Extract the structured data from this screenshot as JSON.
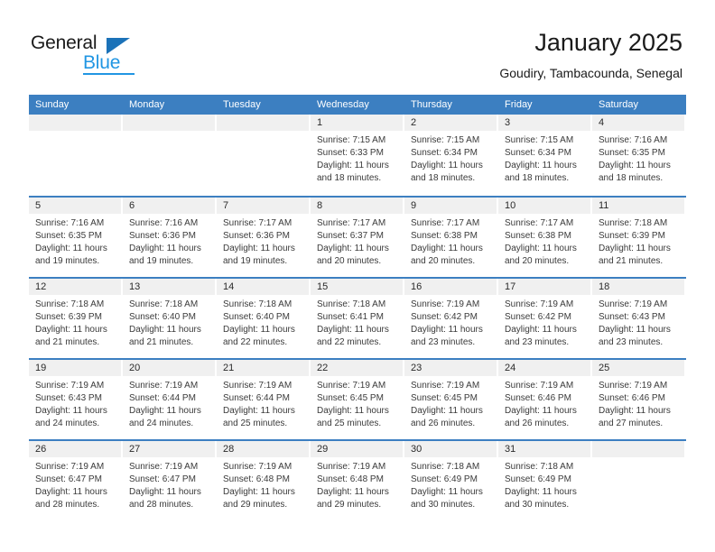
{
  "logo": {
    "word_one": "General",
    "word_two": "Blue",
    "accent_color": "#1b72b8",
    "blue_text_color": "#2196e3"
  },
  "header": {
    "title": "January 2025",
    "subtitle": "Goudiry, Tambacounda, Senegal"
  },
  "calendar": {
    "header_bg": "#3c7fc1",
    "daynum_bg": "#f0f0f0",
    "day_names": [
      "Sunday",
      "Monday",
      "Tuesday",
      "Wednesday",
      "Thursday",
      "Friday",
      "Saturday"
    ],
    "weeks": [
      [
        {
          "day": "",
          "lines": []
        },
        {
          "day": "",
          "lines": []
        },
        {
          "day": "",
          "lines": []
        },
        {
          "day": "1",
          "lines": [
            "Sunrise: 7:15 AM",
            "Sunset: 6:33 PM",
            "Daylight: 11 hours",
            "and 18 minutes."
          ]
        },
        {
          "day": "2",
          "lines": [
            "Sunrise: 7:15 AM",
            "Sunset: 6:34 PM",
            "Daylight: 11 hours",
            "and 18 minutes."
          ]
        },
        {
          "day": "3",
          "lines": [
            "Sunrise: 7:15 AM",
            "Sunset: 6:34 PM",
            "Daylight: 11 hours",
            "and 18 minutes."
          ]
        },
        {
          "day": "4",
          "lines": [
            "Sunrise: 7:16 AM",
            "Sunset: 6:35 PM",
            "Daylight: 11 hours",
            "and 18 minutes."
          ]
        }
      ],
      [
        {
          "day": "5",
          "lines": [
            "Sunrise: 7:16 AM",
            "Sunset: 6:35 PM",
            "Daylight: 11 hours",
            "and 19 minutes."
          ]
        },
        {
          "day": "6",
          "lines": [
            "Sunrise: 7:16 AM",
            "Sunset: 6:36 PM",
            "Daylight: 11 hours",
            "and 19 minutes."
          ]
        },
        {
          "day": "7",
          "lines": [
            "Sunrise: 7:17 AM",
            "Sunset: 6:36 PM",
            "Daylight: 11 hours",
            "and 19 minutes."
          ]
        },
        {
          "day": "8",
          "lines": [
            "Sunrise: 7:17 AM",
            "Sunset: 6:37 PM",
            "Daylight: 11 hours",
            "and 20 minutes."
          ]
        },
        {
          "day": "9",
          "lines": [
            "Sunrise: 7:17 AM",
            "Sunset: 6:38 PM",
            "Daylight: 11 hours",
            "and 20 minutes."
          ]
        },
        {
          "day": "10",
          "lines": [
            "Sunrise: 7:17 AM",
            "Sunset: 6:38 PM",
            "Daylight: 11 hours",
            "and 20 minutes."
          ]
        },
        {
          "day": "11",
          "lines": [
            "Sunrise: 7:18 AM",
            "Sunset: 6:39 PM",
            "Daylight: 11 hours",
            "and 21 minutes."
          ]
        }
      ],
      [
        {
          "day": "12",
          "lines": [
            "Sunrise: 7:18 AM",
            "Sunset: 6:39 PM",
            "Daylight: 11 hours",
            "and 21 minutes."
          ]
        },
        {
          "day": "13",
          "lines": [
            "Sunrise: 7:18 AM",
            "Sunset: 6:40 PM",
            "Daylight: 11 hours",
            "and 21 minutes."
          ]
        },
        {
          "day": "14",
          "lines": [
            "Sunrise: 7:18 AM",
            "Sunset: 6:40 PM",
            "Daylight: 11 hours",
            "and 22 minutes."
          ]
        },
        {
          "day": "15",
          "lines": [
            "Sunrise: 7:18 AM",
            "Sunset: 6:41 PM",
            "Daylight: 11 hours",
            "and 22 minutes."
          ]
        },
        {
          "day": "16",
          "lines": [
            "Sunrise: 7:19 AM",
            "Sunset: 6:42 PM",
            "Daylight: 11 hours",
            "and 23 minutes."
          ]
        },
        {
          "day": "17",
          "lines": [
            "Sunrise: 7:19 AM",
            "Sunset: 6:42 PM",
            "Daylight: 11 hours",
            "and 23 minutes."
          ]
        },
        {
          "day": "18",
          "lines": [
            "Sunrise: 7:19 AM",
            "Sunset: 6:43 PM",
            "Daylight: 11 hours",
            "and 23 minutes."
          ]
        }
      ],
      [
        {
          "day": "19",
          "lines": [
            "Sunrise: 7:19 AM",
            "Sunset: 6:43 PM",
            "Daylight: 11 hours",
            "and 24 minutes."
          ]
        },
        {
          "day": "20",
          "lines": [
            "Sunrise: 7:19 AM",
            "Sunset: 6:44 PM",
            "Daylight: 11 hours",
            "and 24 minutes."
          ]
        },
        {
          "day": "21",
          "lines": [
            "Sunrise: 7:19 AM",
            "Sunset: 6:44 PM",
            "Daylight: 11 hours",
            "and 25 minutes."
          ]
        },
        {
          "day": "22",
          "lines": [
            "Sunrise: 7:19 AM",
            "Sunset: 6:45 PM",
            "Daylight: 11 hours",
            "and 25 minutes."
          ]
        },
        {
          "day": "23",
          "lines": [
            "Sunrise: 7:19 AM",
            "Sunset: 6:45 PM",
            "Daylight: 11 hours",
            "and 26 minutes."
          ]
        },
        {
          "day": "24",
          "lines": [
            "Sunrise: 7:19 AM",
            "Sunset: 6:46 PM",
            "Daylight: 11 hours",
            "and 26 minutes."
          ]
        },
        {
          "day": "25",
          "lines": [
            "Sunrise: 7:19 AM",
            "Sunset: 6:46 PM",
            "Daylight: 11 hours",
            "and 27 minutes."
          ]
        }
      ],
      [
        {
          "day": "26",
          "lines": [
            "Sunrise: 7:19 AM",
            "Sunset: 6:47 PM",
            "Daylight: 11 hours",
            "and 28 minutes."
          ]
        },
        {
          "day": "27",
          "lines": [
            "Sunrise: 7:19 AM",
            "Sunset: 6:47 PM",
            "Daylight: 11 hours",
            "and 28 minutes."
          ]
        },
        {
          "day": "28",
          "lines": [
            "Sunrise: 7:19 AM",
            "Sunset: 6:48 PM",
            "Daylight: 11 hours",
            "and 29 minutes."
          ]
        },
        {
          "day": "29",
          "lines": [
            "Sunrise: 7:19 AM",
            "Sunset: 6:48 PM",
            "Daylight: 11 hours",
            "and 29 minutes."
          ]
        },
        {
          "day": "30",
          "lines": [
            "Sunrise: 7:18 AM",
            "Sunset: 6:49 PM",
            "Daylight: 11 hours",
            "and 30 minutes."
          ]
        },
        {
          "day": "31",
          "lines": [
            "Sunrise: 7:18 AM",
            "Sunset: 6:49 PM",
            "Daylight: 11 hours",
            "and 30 minutes."
          ]
        },
        {
          "day": "",
          "lines": []
        }
      ]
    ]
  }
}
